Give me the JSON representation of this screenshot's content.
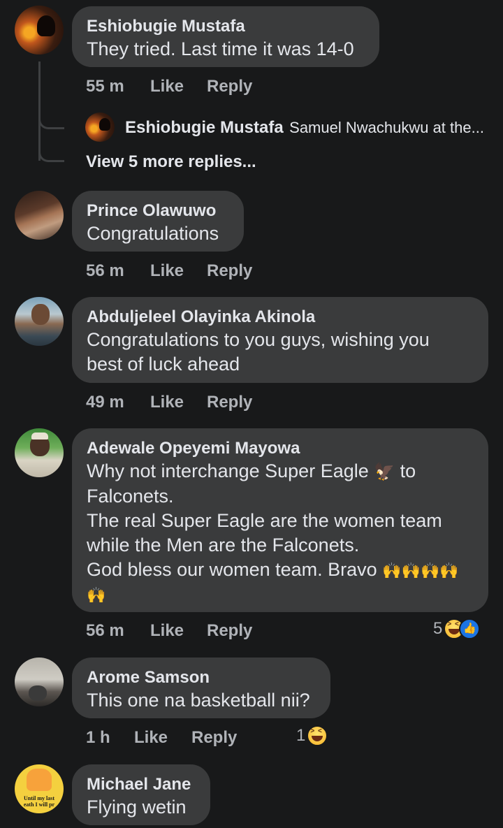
{
  "comments": [
    {
      "name": "Eshiobugie Mustafa",
      "lines": [
        "They tried. Last time it was 14-0"
      ],
      "time": "55 m"
    },
    {
      "name": "Prince Olawuwo",
      "lines": [
        "Congratulations"
      ],
      "time": "56 m"
    },
    {
      "name": "Abduljeleel Olayinka Akinola",
      "lines": [
        "Congratulations to you guys, wishing you",
        "best of luck ahead"
      ],
      "time": "49 m"
    },
    {
      "name": "Adewale Opeyemi Mayowa",
      "lines": [
        "Why not interchange Super Eagle",
        "to",
        "Falconets.",
        "The real Super Eagle are the women team",
        "while the Men are the Falconets.",
        "God bless our women team. Bravo",
        "🙌🙌🙌🙌",
        "🙌"
      ],
      "time": "56 m",
      "react_count": "5"
    },
    {
      "name": "Arome Samson",
      "lines": [
        "This one na basketball nii?"
      ],
      "time": "1 h",
      "react_count": "1"
    },
    {
      "name": "Michael Jane",
      "lines": [
        "Flying wetin"
      ]
    }
  ],
  "actions": {
    "like": "Like",
    "reply": "Reply"
  },
  "reply_preview": {
    "name": "Eshiobugie Mustafa",
    "snippet": "Samuel Nwachukwu at the..."
  },
  "view_more": "View 5 more replies...",
  "avatar_text": {
    "line1": "Until my last",
    "line2": "eath I will pr"
  },
  "colors": {
    "background": "#18191a",
    "bubble": "#3a3b3c",
    "text": "#e4e6eb",
    "meta": "#b0b3b8",
    "like_blue": "#1b74e4"
  },
  "icons": [
    "haha-reaction-icon",
    "like-reaction-icon",
    "eagle-emoji",
    "raised-hands-emoji"
  ]
}
